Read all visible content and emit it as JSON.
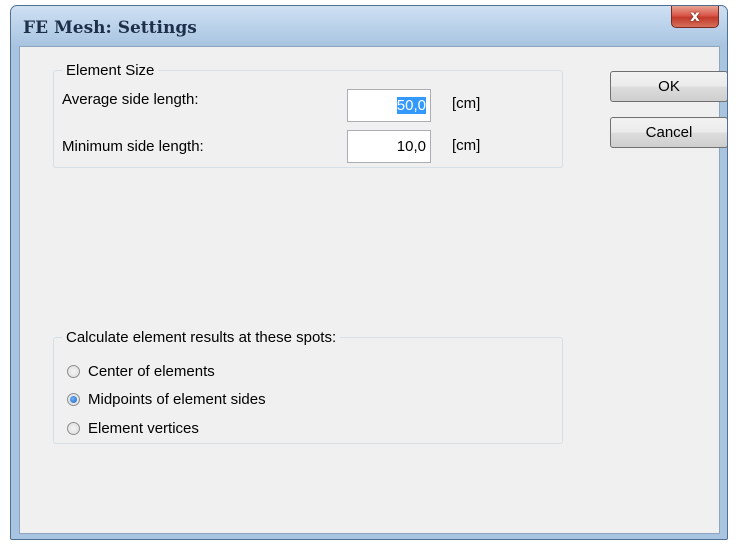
{
  "window": {
    "title": "FE Mesh: Settings",
    "close_glyph": "x"
  },
  "element_size": {
    "legend": "Element Size",
    "average": {
      "label": "Average side length:",
      "value": "50,0",
      "unit": "[cm]"
    },
    "minimum": {
      "label": "Minimum side length:",
      "value": "10,0",
      "unit": "[cm]"
    }
  },
  "buttons": {
    "ok": "OK",
    "cancel": "Cancel"
  },
  "results": {
    "legend": "Calculate element results at these spots:",
    "options": [
      {
        "label": "Center of elements",
        "checked": false
      },
      {
        "label": "Midpoints of element sides",
        "checked": true
      },
      {
        "label": "Element vertices",
        "checked": false
      }
    ]
  }
}
